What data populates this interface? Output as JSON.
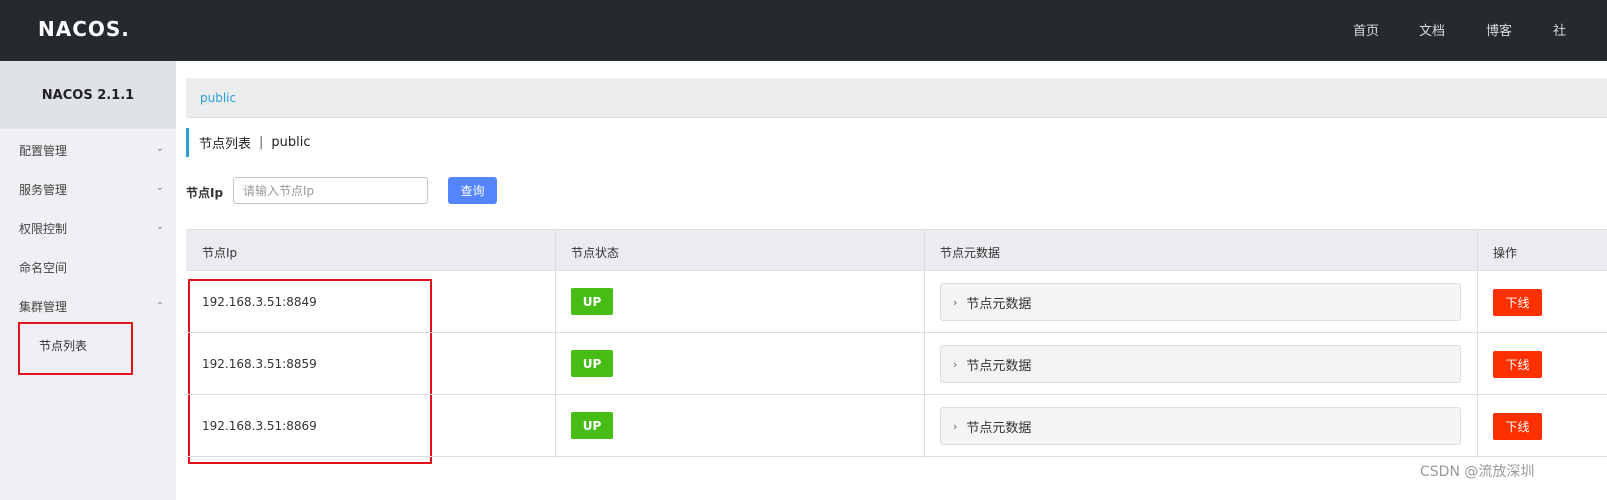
{
  "header": {
    "logo": "NACOS.",
    "nav": [
      "首页",
      "文档",
      "博客",
      "社"
    ]
  },
  "sidebar": {
    "version": "NACOS 2.1.1",
    "items": [
      {
        "label": "配置管理",
        "expanded": false
      },
      {
        "label": "服务管理",
        "expanded": false
      },
      {
        "label": "权限控制",
        "expanded": false
      },
      {
        "label": "命名空间"
      },
      {
        "label": "集群管理",
        "expanded": true
      }
    ],
    "sub_item": "节点列表"
  },
  "breadcrumb": {
    "namespace": "public"
  },
  "page_title": {
    "title": "节点列表",
    "separator": "|",
    "namespace": "public"
  },
  "filter": {
    "label": "节点Ip",
    "placeholder": "请输入节点Ip",
    "value": "",
    "query_label": "查询"
  },
  "table": {
    "headers": [
      "节点Ip",
      "节点状态",
      "节点元数据",
      "操作"
    ],
    "rows": [
      {
        "ip": "192.168.3.51:8849",
        "status": "UP",
        "meta": "节点元数据",
        "action": "下线"
      },
      {
        "ip": "192.168.3.51:8859",
        "status": "UP",
        "meta": "节点元数据",
        "action": "下线"
      },
      {
        "ip": "192.168.3.51:8869",
        "status": "UP",
        "meta": "节点元数据",
        "action": "下线"
      }
    ]
  },
  "colors": {
    "topbar": "#252a2f",
    "accent": "#2a9fd6",
    "primary_button": "#5584ff",
    "status_up": "#46bc15",
    "danger": "#ff3000",
    "highlight": "#e0111c"
  },
  "watermark": "CSDN @流放深圳"
}
